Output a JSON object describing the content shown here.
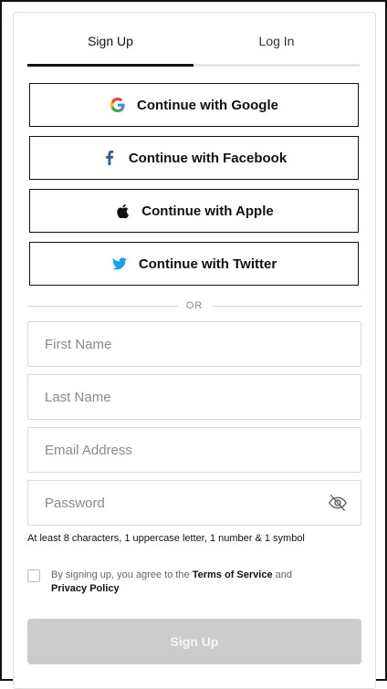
{
  "tabs": [
    {
      "label": "Sign Up",
      "active": true
    },
    {
      "label": "Log In",
      "active": false
    }
  ],
  "social": {
    "google": "Continue with Google",
    "facebook": "Continue with Facebook",
    "apple": "Continue with Apple",
    "twitter": "Continue with Twitter"
  },
  "divider": "OR",
  "fields": {
    "first_name": {
      "placeholder": "First Name",
      "value": ""
    },
    "last_name": {
      "placeholder": "Last Name",
      "value": ""
    },
    "email": {
      "placeholder": "Email Address",
      "value": ""
    },
    "password": {
      "placeholder": "Password",
      "value": ""
    }
  },
  "password_hint": "At least 8 characters, 1 uppercase letter, 1 number & 1 symbol",
  "agreement": {
    "prefix": "By signing up, you agree to the ",
    "terms": "Terms of Service",
    "and": " and",
    "privacy": "Privacy Policy",
    "checked": false
  },
  "submit_label": "Sign Up",
  "colors": {
    "text": "#111111",
    "border": "#d9d9d9",
    "disabled_button": "#cccccc",
    "facebook": "#3b5998",
    "twitter": "#1da1f2"
  }
}
